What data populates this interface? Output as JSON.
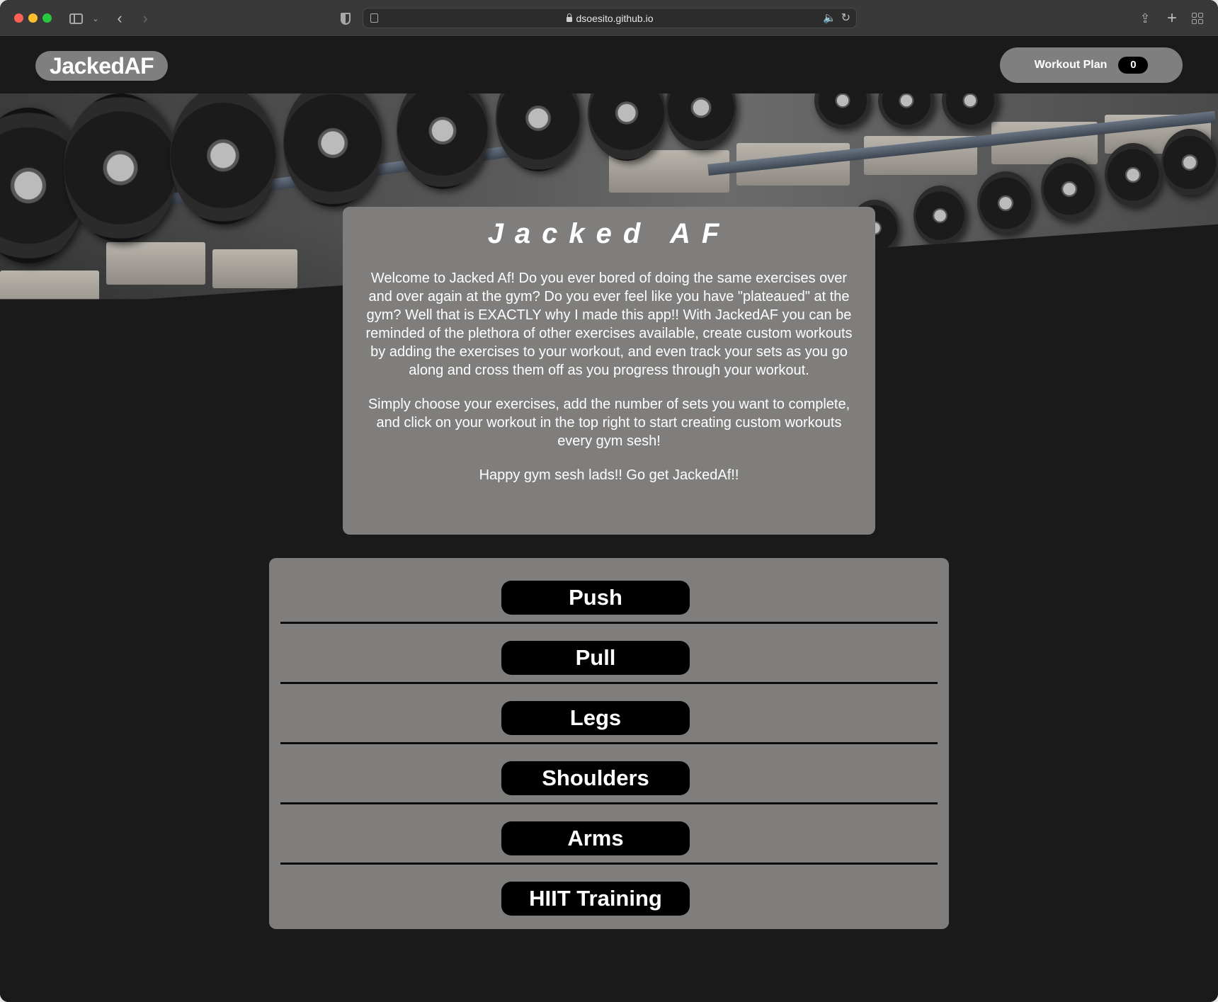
{
  "browser": {
    "url": "dsoesito.github.io"
  },
  "navbar": {
    "brand": "JackedAF",
    "workout_plan_label": "Workout Plan",
    "workout_plan_count": "0"
  },
  "intro": {
    "title": "Jacked AF",
    "paragraphs": [
      "Welcome to Jacked Af! Do you ever bored of doing the same exercises over and over again at the gym? Do you ever feel like you have \"plateaued\" at the gym? Well that is EXACTLY why I made this app!! With JackedAF you can be reminded of the plethora of other exercises available, create custom workouts by adding the exercises to your workout, and even track your sets as you go along and cross them off as you progress through your workout.",
      "Simply choose your exercises, add the number of sets you want to complete, and click on your workout in the top right to start creating custom workouts every gym sesh!",
      "Happy gym sesh lads!! Go get JackedAf!!"
    ]
  },
  "categories": [
    "Push",
    "Pull",
    "Legs",
    "Shoulders",
    "Arms",
    "HIIT Training"
  ],
  "icons": {
    "sidebar": "sidebar-icon",
    "back": "chevron-left-icon",
    "forward": "chevron-right-icon",
    "shield": "shield-icon",
    "lock": "lock-icon",
    "audio": "speaker-icon",
    "reload": "reload-icon",
    "share": "share-icon",
    "new_tab": "plus-icon",
    "tab_overview": "grid-icon"
  },
  "colors": {
    "page_bg": "#1a1a1a",
    "card_bg": "#7f7e7c",
    "button_bg": "#000000"
  }
}
